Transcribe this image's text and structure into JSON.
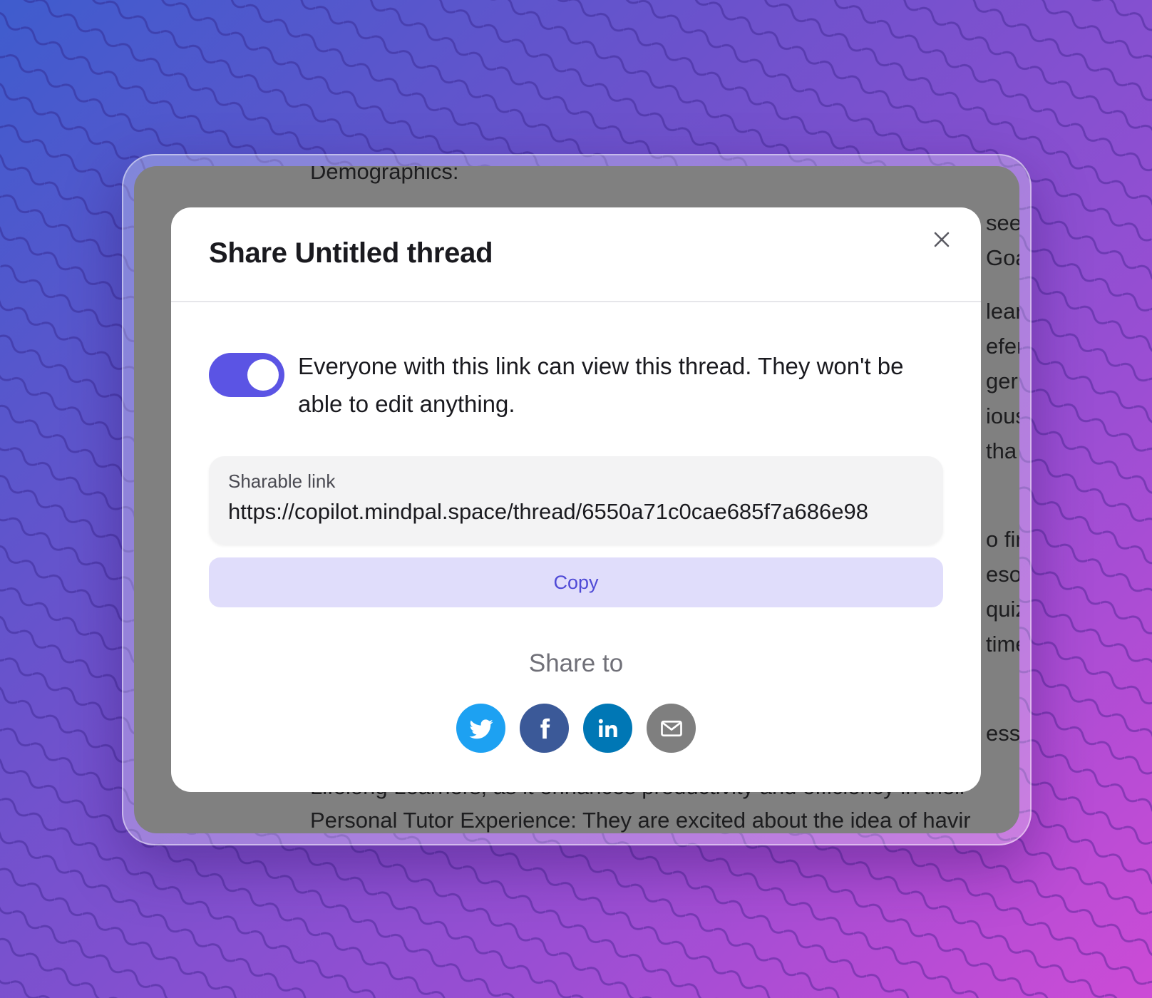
{
  "background_document": {
    "heading": "Demographics:",
    "bottom_lines": [
      "Lifelong Learners, as it enhances productivity and efficiency in their",
      "Personal Tutor Experience: They are excited about the idea of havir"
    ],
    "right_fragments": [
      "see",
      "Goa",
      "lear",
      "efer",
      "ger",
      "ious",
      "tha",
      "o fir",
      "esou",
      "quiz",
      "time",
      "ess"
    ]
  },
  "modal": {
    "title": "Share Untitled thread",
    "close_icon": "close-icon",
    "share_toggle": {
      "enabled": true,
      "description": "Everyone with this link can view this thread. They won't be able to edit anything."
    },
    "link": {
      "label": "Sharable link",
      "url": "https://copilot.mindpal.space/thread/6550a71c0cae685f7a686e98"
    },
    "copy_label": "Copy",
    "share_heading": "Share to",
    "share_targets": [
      {
        "name": "twitter-icon",
        "color": "#1da1f2"
      },
      {
        "name": "facebook-icon",
        "color": "#3b5998"
      },
      {
        "name": "linkedin-icon",
        "color": "#0077b5"
      },
      {
        "name": "email-icon",
        "color": "#7f7f7f"
      }
    ]
  },
  "colors": {
    "accent": "#5b54e4",
    "copy_button_bg": "#e0ddfb",
    "copy_button_text": "#4f4ad6",
    "overlay": "#808080"
  }
}
